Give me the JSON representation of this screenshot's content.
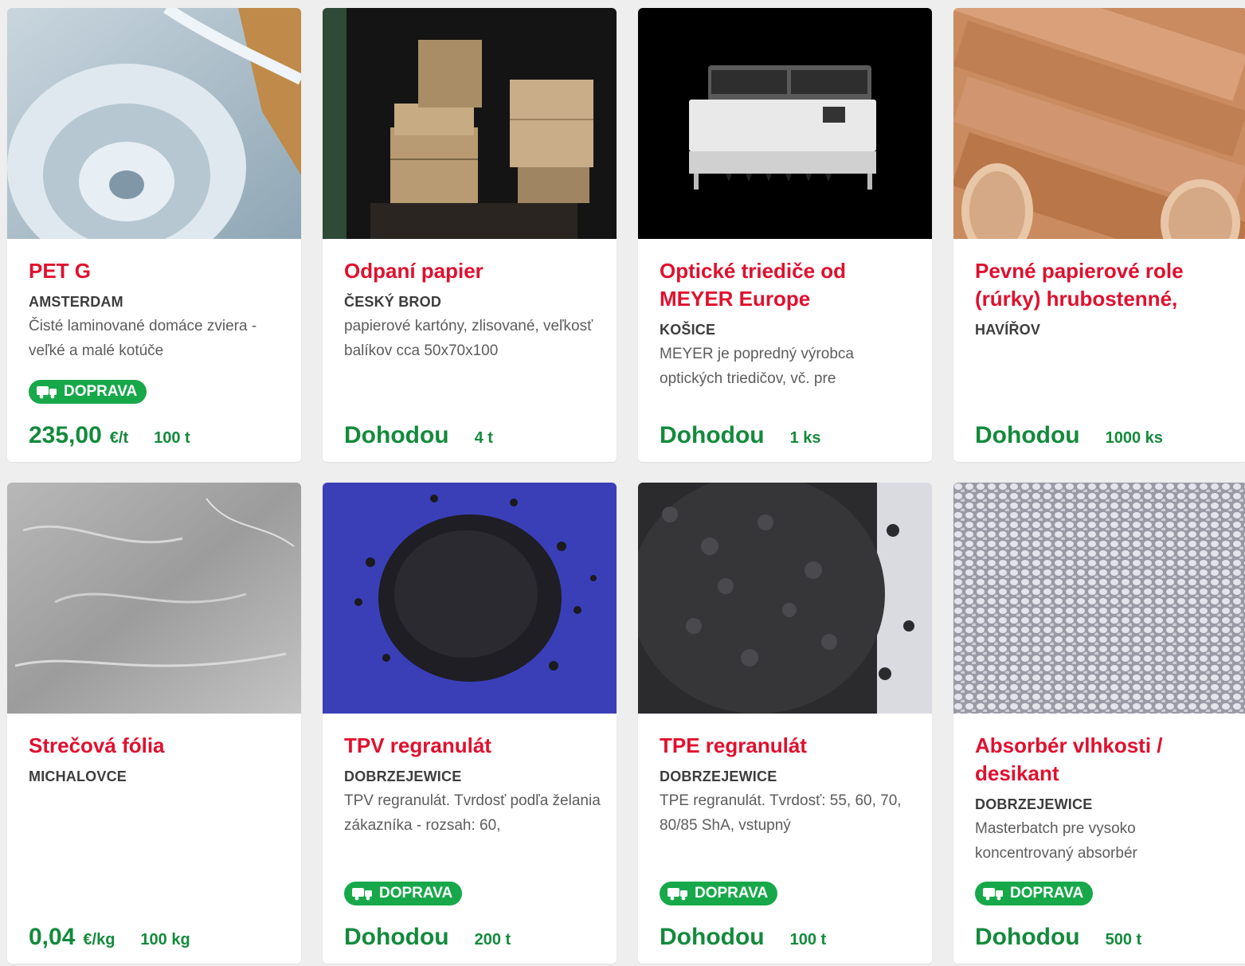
{
  "colors": {
    "page_background": "#eeeeee",
    "title_red": "#e0102e",
    "price_green": "#138a3c",
    "badge_green": "#17a84a"
  },
  "listings": [
    {
      "title": "PET G",
      "city": "AMSTERDAM",
      "description": "Čisté laminované domáce zviera - veľké a malé kotúče",
      "badge": "DOPRAVA",
      "price": "235,00",
      "price_unit": "€/t",
      "quantity": "100 t",
      "image": "transparent-plastic-rolls"
    },
    {
      "title": "Odpaní papier",
      "city": "ČESKÝ BROD",
      "description": "papierové kartóny, zlisované, veľkosť balíkov cca 50x70x100",
      "price": "Dohodou",
      "quantity": "4 t",
      "image": "baled-paper-in-container"
    },
    {
      "title": "Optické triediče od MEYER Europe",
      "city": "KOŠICE",
      "description": "MEYER je popredný výrobca optických triedičov, vč. pre",
      "price": "Dohodou",
      "quantity": "1 ks",
      "image": "optical-sorter-machine"
    },
    {
      "title": "Pevné papierové role (rúrky) hrubostenné,",
      "city": "HAVÍŘOV",
      "description": "",
      "price": "Dohodou",
      "quantity": "1000 ks",
      "image": "cardboard-tubes"
    },
    {
      "title": "Strečová fólia",
      "city": "MICHALOVCE",
      "description": "",
      "price": "0,04",
      "price_unit": "€/kg",
      "quantity": "100 kg",
      "image": "stretch-film"
    },
    {
      "title": "TPV regranulát",
      "city": "DOBRZEJEWICE",
      "description": "TPV regranulát. Tvrdosť podľa želania zákazníka - rozsah: 60,",
      "badge": "DOPRAVA",
      "price": "Dohodou",
      "quantity": "200 t",
      "image": "black-granules-on-blue"
    },
    {
      "title": "TPE regranulát",
      "city": "DOBRZEJEWICE",
      "description": "TPE regranulát. Tvrdosť: 55, 60, 70, 80/85 ShA, vstupný",
      "badge": "DOPRAVA",
      "price": "Dohodou",
      "quantity": "100 t",
      "image": "black-granules"
    },
    {
      "title": "Absorbér vlhkosti / desikant",
      "city": "DOBRZEJEWICE",
      "description": "Masterbatch pre vysoko koncentrovaný absorbér",
      "badge": "DOPRAVA",
      "price": "Dohodou",
      "quantity": "500 t",
      "image": "white-granules"
    }
  ]
}
